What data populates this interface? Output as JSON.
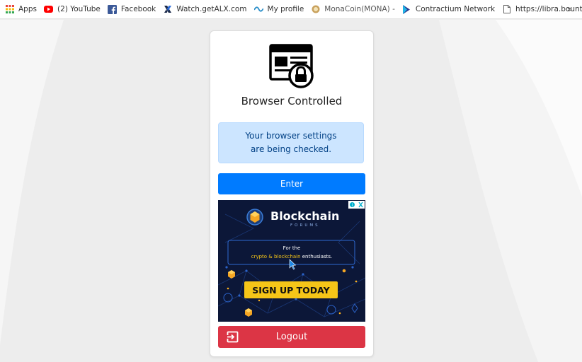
{
  "bookmarks": [
    {
      "label": "Apps",
      "icon": "apps-grid-icon"
    },
    {
      "label": "(2) YouTube",
      "icon": "youtube-icon"
    },
    {
      "label": "Facebook",
      "icon": "facebook-icon"
    },
    {
      "label": "Watch.getALX.com",
      "icon": "alx-icon"
    },
    {
      "label": "My profile",
      "icon": "myprofile-icon"
    },
    {
      "label": "MonaCoin(MONA) - ",
      "icon": "monacoin-icon"
    },
    {
      "label": "Contractium Network",
      "icon": "contractium-icon"
    },
    {
      "label": "https://libra.bounty.g",
      "icon": "page-icon"
    }
  ],
  "bookmarks_more": "»",
  "card": {
    "title": "Browser Controlled",
    "alert_text": "Your browser settings are being checked.",
    "enter_label": "Enter",
    "logout_label": "Logout"
  },
  "ad": {
    "brand": "Blockchain",
    "brand_sub": "FORUMS",
    "tagline_line1": "For the",
    "tagline_highlight": "crypto & blockchain",
    "tagline_rest": " enthusiasts.",
    "cta": "SIGN UP TODAY"
  },
  "colors": {
    "primary": "#007bff",
    "danger": "#dc3545",
    "alert_bg": "#cce5ff",
    "ad_bg": "#0c1738",
    "ad_accent": "#f5c518"
  }
}
